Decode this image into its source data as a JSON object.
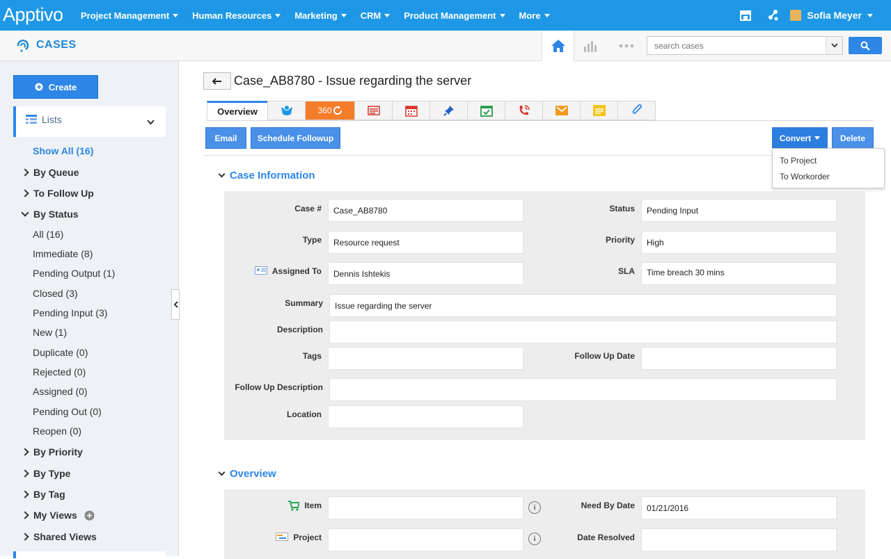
{
  "brand": {
    "logo": "Apptivo"
  },
  "nav": {
    "items": [
      "Project Management",
      "Human Resources",
      "Marketing",
      "CRM",
      "Product Management",
      "More"
    ]
  },
  "user": {
    "name": "Sofia Meyer"
  },
  "app": {
    "title": "CASES"
  },
  "search": {
    "placeholder": "search cases"
  },
  "sidebar": {
    "create_label": "Create",
    "lists_label": "Lists",
    "show_all": "Show All (16)",
    "groups": {
      "by_queue": "By Queue",
      "to_follow_up": "To Follow Up",
      "by_status": "By Status",
      "by_priority": "By Priority",
      "by_type": "By Type",
      "by_tag": "By Tag",
      "my_views": "My Views",
      "shared_views": "Shared Views"
    },
    "status_items": [
      "All  (16)",
      "Immediate  (8)",
      "Pending Output  (1)",
      "Closed  (3)",
      "Pending Input  (3)",
      "New  (1)",
      "Duplicate  (0)",
      "Rejected  (0)",
      "Assigned  (0)",
      "Pending Out  (0)",
      "Reopen  (0)"
    ]
  },
  "case": {
    "title": "Case_AB8780 - Issue regarding the server"
  },
  "tabs": {
    "overview": "Overview",
    "t360": "360"
  },
  "actions": {
    "email": "Email",
    "schedule": "Schedule Followup",
    "convert": "Convert",
    "delete": "Delete",
    "convert_menu": [
      "To Project",
      "To Workorder"
    ]
  },
  "case_info": {
    "title": "Case Information",
    "labels": {
      "case_no": "Case #",
      "status": "Status",
      "type": "Type",
      "priority": "Priority",
      "assigned_to": "Assigned To",
      "sla": "SLA",
      "summary": "Summary",
      "description": "Description",
      "tags": "Tags",
      "follow_up_date": "Follow Up Date",
      "follow_up_description": "Follow Up Description",
      "location": "Location"
    },
    "values": {
      "case_no": "Case_AB8780",
      "status": "Pending Input",
      "type": "Resource request",
      "priority": "High",
      "assigned_to": "Dennis Ishtekis",
      "sla": "Time breach 30 mins",
      "summary": "Issue regarding the server",
      "description": "",
      "tags": "",
      "follow_up_date": "",
      "follow_up_description": "",
      "location": ""
    }
  },
  "overview": {
    "title": "Overview",
    "labels": {
      "item": "Item",
      "need_by_date": "Need By Date",
      "project": "Project",
      "date_resolved": "Date Resolved"
    },
    "values": {
      "item": "",
      "need_by_date": "01/21/2016",
      "project": "",
      "date_resolved": ""
    }
  },
  "colors": {
    "brand": "#1e98e6",
    "button": "#4a90e8",
    "tab_360": "#f47d2a"
  }
}
